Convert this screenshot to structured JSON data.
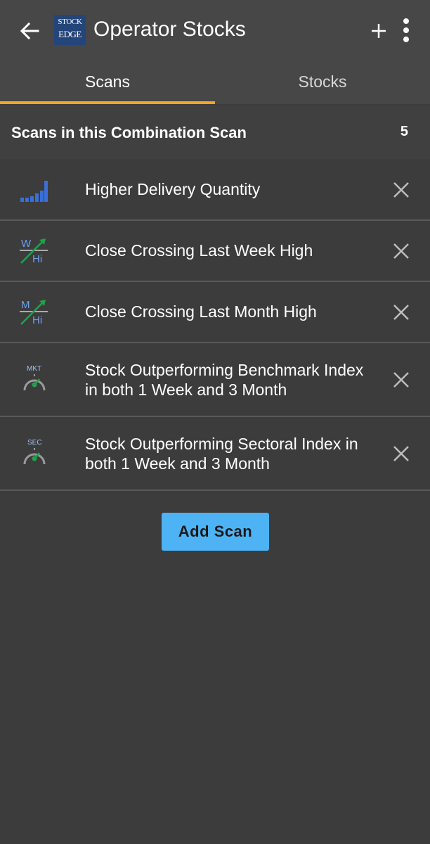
{
  "appbar": {
    "title": "Operator Stocks",
    "logo_line1": "STOCK",
    "logo_line2": "EDGE",
    "back_icon": "arrow-left-icon",
    "add_icon": "plus-icon",
    "menu_icon": "more-vertical-icon"
  },
  "tabs": [
    {
      "label": "Scans",
      "active": true
    },
    {
      "label": "Stocks",
      "active": false
    }
  ],
  "section": {
    "title": "Scans in this Combination Scan",
    "count": "5"
  },
  "scans": [
    {
      "label": "Higher Delivery Quantity",
      "icon": "delivery-bars-icon"
    },
    {
      "label": "Close Crossing Last Week High",
      "icon": "week-high-icon",
      "icon_text_top": "W",
      "icon_text_bottom": "Hi"
    },
    {
      "label": "Close Crossing Last Month High",
      "icon": "month-high-icon",
      "icon_text_top": "M",
      "icon_text_bottom": "Hi"
    },
    {
      "label": "Stock Outperforming Benchmark Index in both 1 Week and 3 Month",
      "icon": "mkt-gauge-icon",
      "icon_text_top": "MKT"
    },
    {
      "label": "Stock Outperforming Sectoral Index in both 1 Week and 3 Month",
      "icon": "sec-gauge-icon",
      "icon_text_top": "SEC"
    }
  ],
  "add_scan_label": "Add Scan",
  "colors": {
    "background": "#3c3c3c",
    "appbar": "#474747",
    "tab_indicator": "#f5a623",
    "button": "#4db3f4",
    "icon_blue": "#3a6fd8",
    "icon_green": "#1fa34a"
  }
}
